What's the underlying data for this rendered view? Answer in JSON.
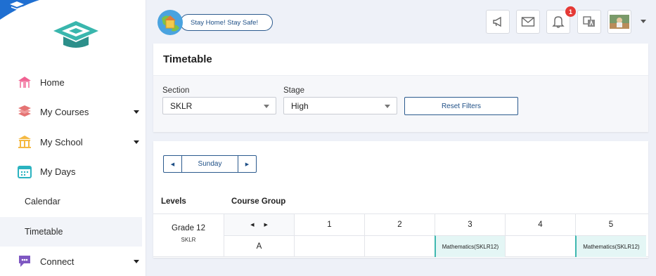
{
  "sidebar": {
    "items": [
      {
        "label": "Home",
        "icon": "home-icon"
      },
      {
        "label": "My Courses",
        "icon": "books-icon"
      },
      {
        "label": "My School",
        "icon": "school-icon"
      },
      {
        "label": "My Days",
        "icon": "calendar-icon"
      }
    ],
    "sub_items": [
      {
        "label": "Calendar"
      },
      {
        "label": "Timetable"
      }
    ],
    "connect_label": "Connect"
  },
  "header": {
    "banner_text": "Stay Home! Stay Safe!",
    "notification_count": "1",
    "icons": [
      "megaphone-icon",
      "mail-icon",
      "bell-icon",
      "translate-icon"
    ]
  },
  "timetable_card": {
    "title": "Timetable",
    "section_label": "Section",
    "section_value": "SKLR",
    "stage_label": "Stage",
    "stage_value": "High",
    "reset_label": "Reset Filters"
  },
  "schedule": {
    "day": "Sunday",
    "levels_header": "Levels",
    "course_group_header": "Course Group",
    "periods": [
      "1",
      "2",
      "3",
      "4",
      "5"
    ],
    "grade": "Grade 12",
    "section": "SKLR",
    "group": "A",
    "cells": [
      "",
      "",
      "Mathematics(SKLR12)",
      "",
      "Mathematics(SKLR12)"
    ]
  },
  "colors": {
    "accent": "#2c5b8e",
    "teal": "#3fb8b0",
    "filled_cell": "#e4f6f5",
    "background": "#eef1f8"
  }
}
